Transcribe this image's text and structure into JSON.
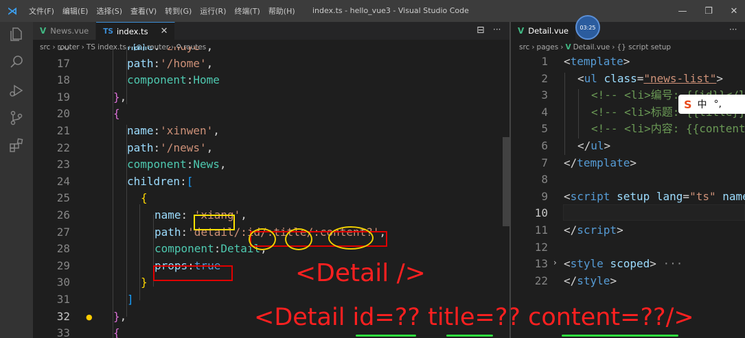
{
  "titlebar": {
    "menu": [
      "文件(F)",
      "编辑(E)",
      "选择(S)",
      "查看(V)",
      "转到(G)",
      "运行(R)",
      "终端(T)",
      "帮助(H)"
    ],
    "title": "index.ts - hello_vue3 - Visual Studio Code",
    "minimize": "—",
    "restore": "❐",
    "close": "✕"
  },
  "left_editor": {
    "tabs": [
      {
        "icon": "V",
        "label": "News.vue"
      },
      {
        "icon": "TS",
        "label": "index.ts",
        "close": "✕"
      }
    ],
    "split_icon": "⊟",
    "more_icon": "···",
    "breadcrumb": [
      "src",
      "router",
      "TS index.ts",
      "router",
      "routes"
    ],
    "line_numbers": [
      "16",
      "17",
      "18",
      "19",
      "20",
      "21",
      "22",
      "23",
      "24",
      "25",
      "26",
      "27",
      "28",
      "29",
      "30",
      "31",
      "32",
      "33"
    ],
    "current_line": "32"
  },
  "right_editor": {
    "tab": {
      "icon": "V",
      "label": "Detail.vue"
    },
    "more_icon": "···",
    "breadcrumb": [
      "src",
      "pages",
      "Detail.vue",
      "{} script setup"
    ],
    "line_numbers": [
      "1",
      "2",
      "3",
      "4",
      "5",
      "6",
      "7",
      "8",
      "9",
      "10",
      "11",
      "12",
      "13",
      "22"
    ],
    "current_line": "10"
  },
  "annotations": {
    "detail_tag": "<Detail />",
    "detail_props": "<Detail id=?? title=?? content=??/>"
  },
  "ime": {
    "logo": "S",
    "lang": "中",
    "punct": "°,"
  },
  "timer": "03:25"
}
